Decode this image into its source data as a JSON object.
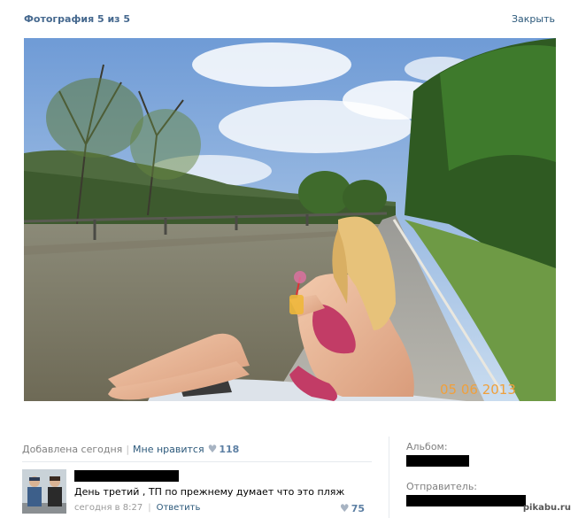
{
  "header": {
    "title": "Фотография 5 из 5",
    "close_label": "Закрыть"
  },
  "photo": {
    "date_stamp": "05 06 2013"
  },
  "info": {
    "added": "Добавлена сегодня",
    "like_label": "Мне нравится",
    "like_count": "118"
  },
  "comment": {
    "text": "День третий , ТП по прежнему думает что это пляж",
    "time": "сегодня в 8:27",
    "reply_label": "Ответить",
    "likes": "75"
  },
  "sidebar": {
    "album_label": "Альбом:",
    "sender_label": "Отправитель:"
  },
  "watermark": "pikabu.ru",
  "colors": {
    "link": "#2b587a",
    "title": "#45688e",
    "muted": "#808080"
  }
}
